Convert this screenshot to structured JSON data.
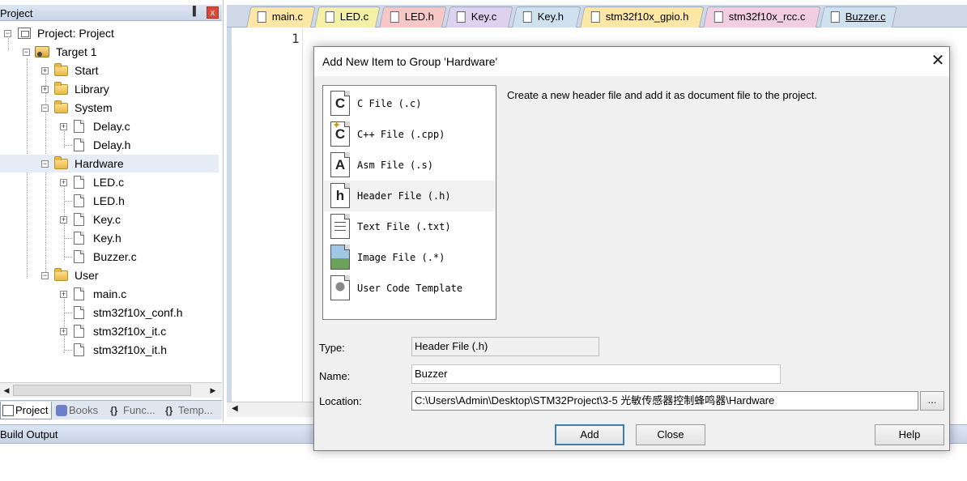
{
  "project_panel": {
    "title": "Project",
    "pin": "▐",
    "close": "x",
    "tree": [
      {
        "label": "Project: Project",
        "icon": "project-icon"
      },
      {
        "label": "Target 1",
        "icon": "target-icon"
      },
      {
        "label": "Start",
        "icon": "folder-icon"
      },
      {
        "label": "Library",
        "icon": "folder-icon"
      },
      {
        "label": "System",
        "icon": "folder-open-icon"
      },
      {
        "label": "Delay.c",
        "icon": "file-icon"
      },
      {
        "label": "Delay.h",
        "icon": "file-icon"
      },
      {
        "label": "Hardware",
        "icon": "folder-open-icon"
      },
      {
        "label": "LED.c",
        "icon": "file-icon"
      },
      {
        "label": "LED.h",
        "icon": "file-icon"
      },
      {
        "label": "Key.c",
        "icon": "file-icon"
      },
      {
        "label": "Key.h",
        "icon": "file-icon"
      },
      {
        "label": "Buzzer.c",
        "icon": "file-icon"
      },
      {
        "label": "User",
        "icon": "folder-open-icon"
      },
      {
        "label": "main.c",
        "icon": "file-icon"
      },
      {
        "label": "stm32f10x_conf.h",
        "icon": "file-icon"
      },
      {
        "label": "stm32f10x_it.c",
        "icon": "file-icon"
      },
      {
        "label": "stm32f10x_it.h",
        "icon": "file-icon"
      }
    ],
    "tabs": [
      "Project",
      "Books",
      "Func...",
      "Temp..."
    ]
  },
  "editor": {
    "tabs": [
      {
        "label": "main.c",
        "color": "#fde7a6"
      },
      {
        "label": "LED.c",
        "color": "#f4f0a8"
      },
      {
        "label": "LED.h",
        "color": "#f7c7c7"
      },
      {
        "label": "Key.c",
        "color": "#dcd2ef"
      },
      {
        "label": "Key.h",
        "color": "#cfe0ef"
      },
      {
        "label": "stm32f10x_gpio.h",
        "color": "#fde7a6"
      },
      {
        "label": "stm32f10x_rcc.c",
        "color": "#f2cfe0"
      },
      {
        "label": "Buzzer.c",
        "color": "#cfe0ef"
      }
    ],
    "line_number": "1"
  },
  "build_output": {
    "title": "Build Output"
  },
  "dialog": {
    "title": "Add New Item to Group 'Hardware'",
    "close": "✕",
    "description": "Create a new header file and add it as document file to the project.",
    "file_types": [
      {
        "label": "C File (.c)",
        "icon_glyph": "C"
      },
      {
        "label": "C++ File (.cpp)",
        "icon_glyph": "C"
      },
      {
        "label": "Asm File (.s)",
        "icon_glyph": "A"
      },
      {
        "label": "Header File (.h)",
        "icon_glyph": "h"
      },
      {
        "label": "Text File (.txt)",
        "icon_glyph": ""
      },
      {
        "label": "Image File (.*)",
        "icon_glyph": ""
      },
      {
        "label": "User Code Template",
        "icon_glyph": ""
      }
    ],
    "selected_index": 3,
    "type_label": "Type:",
    "type_value": "Header File (.h)",
    "name_label": "Name:",
    "name_value": "Buzzer",
    "location_label": "Location:",
    "location_value": "C:\\Users\\Admin\\Desktop\\STM32Project\\3-5 光敏传感器控制蜂鸣器\\Hardware",
    "browse_label": "...",
    "add_label": "Add",
    "close_label": "Close",
    "help_label": "Help"
  }
}
